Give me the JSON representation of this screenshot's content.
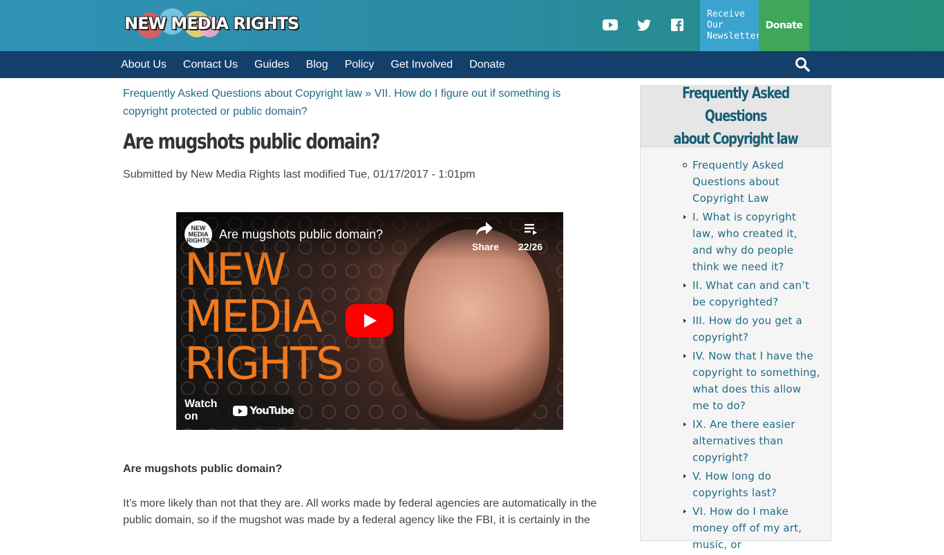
{
  "header": {
    "logo_text": "NEW MEDIA RIGHTS",
    "newsletter_lines": [
      "Receive",
      "Our",
      "Newsletter"
    ],
    "donate_label": "Donate",
    "social_icons": [
      "youtube-icon",
      "twitter-icon",
      "facebook-icon"
    ]
  },
  "nav": {
    "items": [
      "About Us",
      "Contact Us",
      "Guides",
      "Blog",
      "Policy",
      "Get Involved",
      "Donate"
    ]
  },
  "breadcrumb": {
    "link1": "Frequently Asked Questions about Copyright law",
    "separator": "»",
    "link2": "VII. How do I figure out if something is copyright protected or public domain?"
  },
  "article": {
    "title": "Are mugshots public domain?",
    "submitted": "Submitted by New Media Rights last modified Tue, 01/17/2017 - 1:01pm",
    "subhead": "Are mugshots public domain?",
    "body": "It’s more likely than not that they are. All works made by federal agencies are automatically in the public domain, so if the mugshot was made by a federal agency like the FBI, it is certainly in the"
  },
  "video": {
    "channel_logo_text": "NEW MEDIA RIGHTS",
    "title": "Are mugshots public domain?",
    "share_label": "Share",
    "playlist_count": "22/26",
    "overlay_logo": [
      "NEW",
      "MEDIA",
      "RIGHTS"
    ],
    "watch_on": "Watch on",
    "youtube_wordmark": "YouTube"
  },
  "sidebar": {
    "title_lines": [
      "Frequently Asked Questions",
      "about Copyright law"
    ],
    "items": [
      "Frequently Asked Questions about Copyright Law",
      "I. What is copyright law, who created it, and why do people think we need it?",
      "II. What can and can’t be copyrighted?",
      "III. How do you get a copyright?",
      "IV. Now that I have the copyright to something, what does this allow me to do?",
      "IX. Are there easier alternatives than copyright?",
      "V. How long do copyrights last?",
      "VI. How do I make money off of my art, music, or"
    ]
  },
  "colors": {
    "nav_bg": "#133f6b",
    "link": "#1f6b86",
    "donate_bg": "#3fa65a",
    "newsletter_bg": "#3ba3cf"
  }
}
